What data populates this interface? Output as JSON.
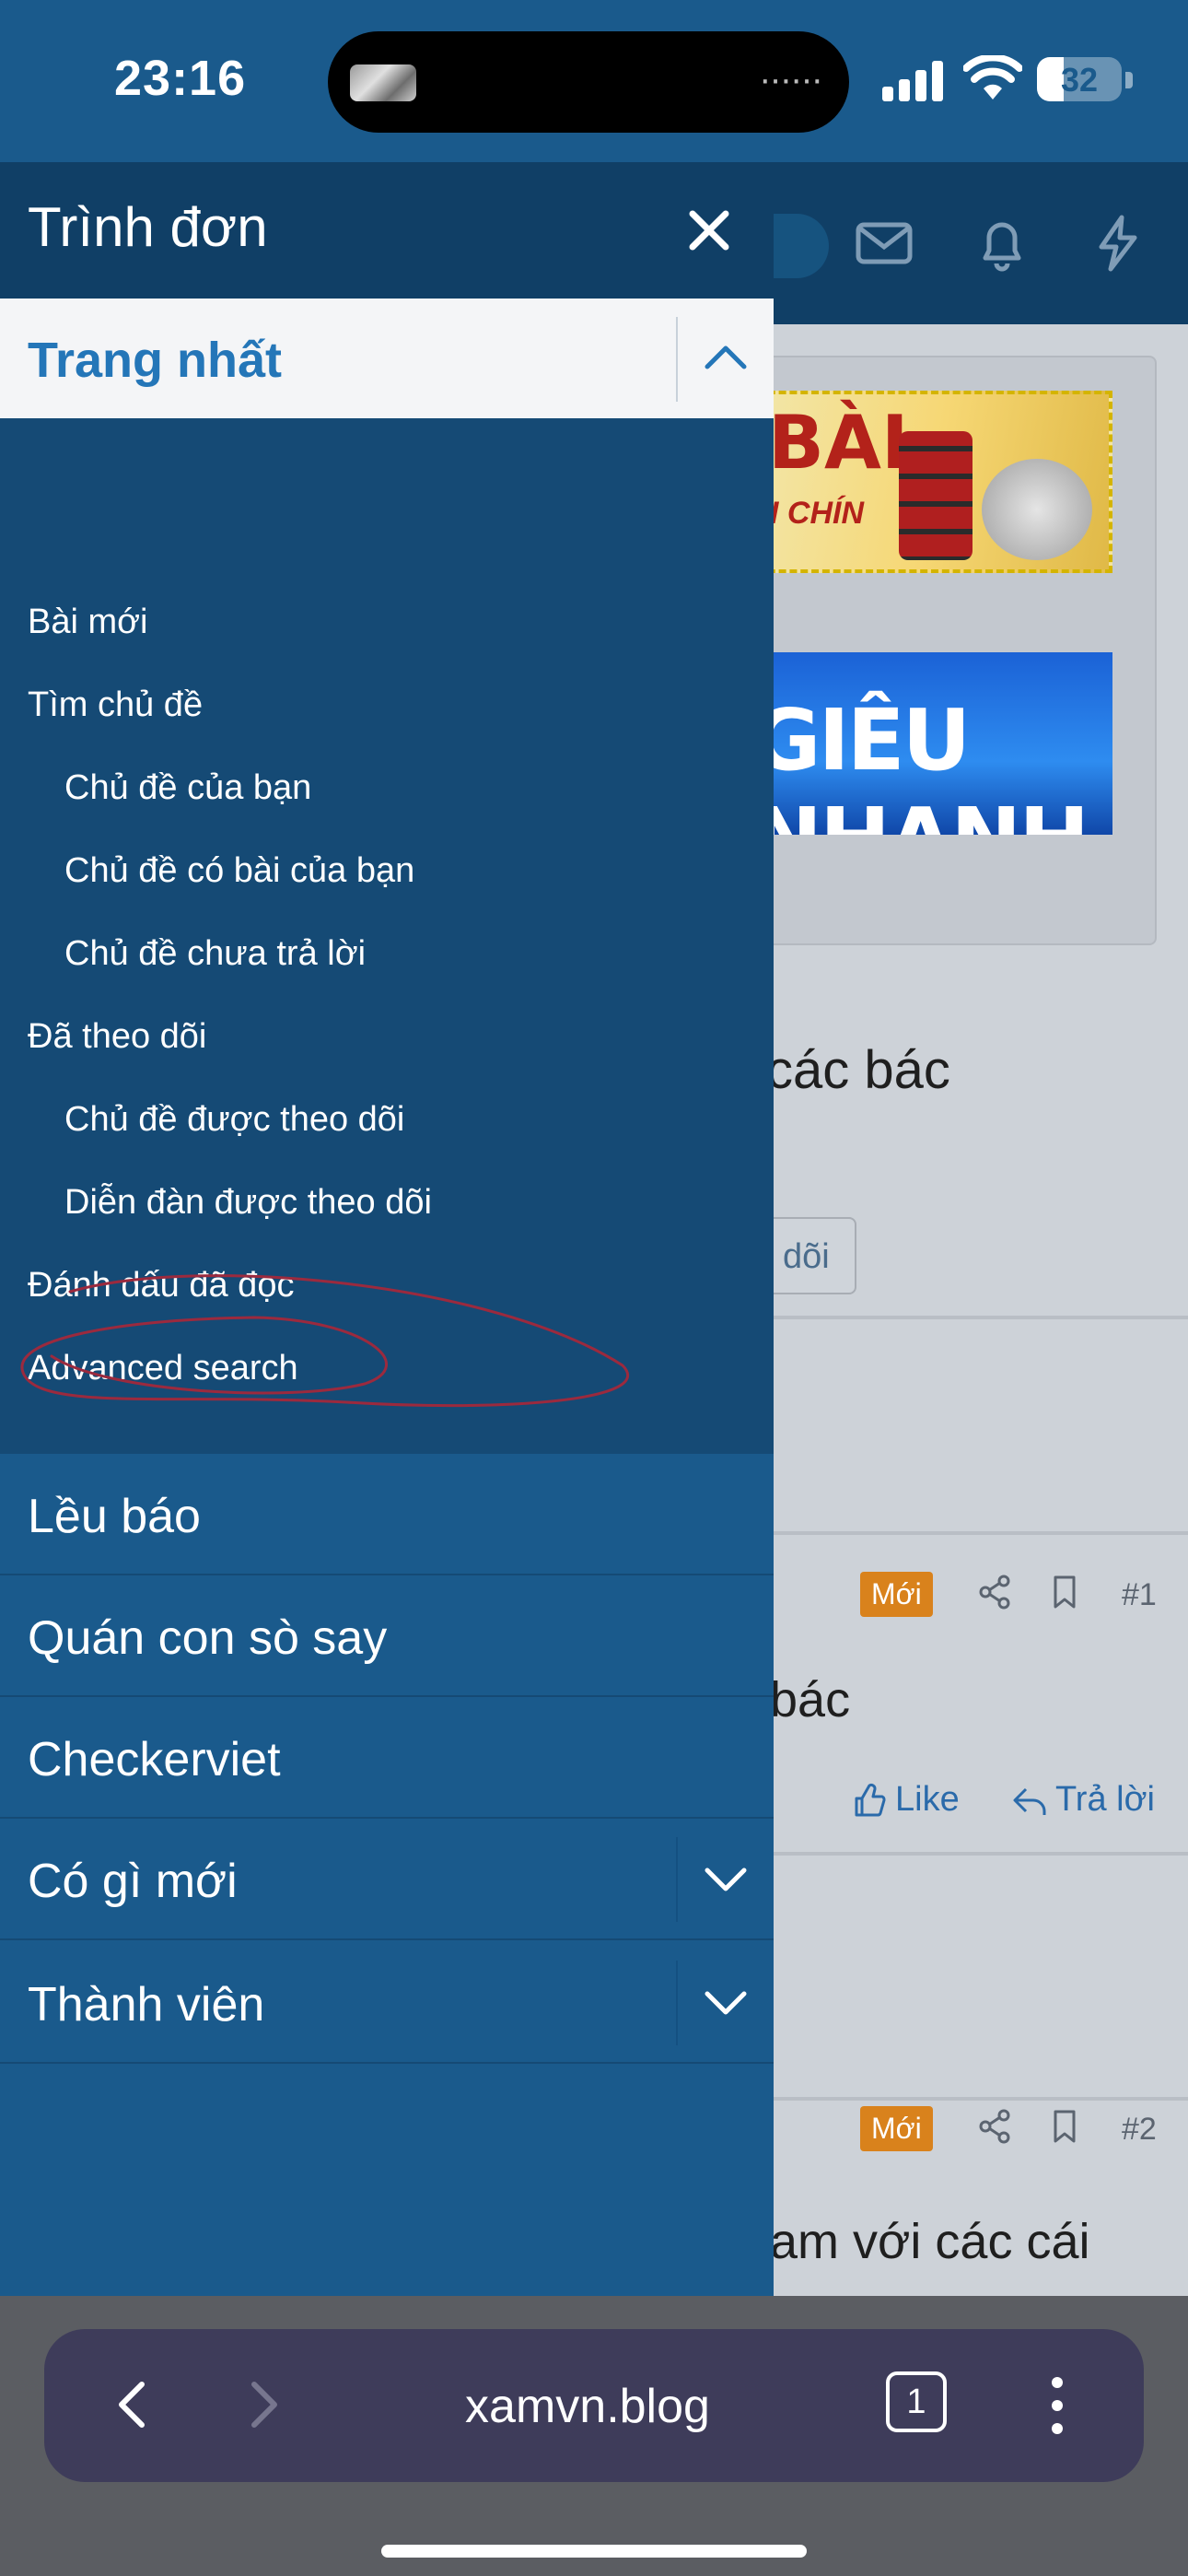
{
  "status_bar": {
    "time": "23:16",
    "battery_level": "32",
    "battery_fraction": 0.32
  },
  "menu": {
    "title": "Trình đơn",
    "active_item": {
      "label": "Trang nhất"
    },
    "subitems": [
      {
        "label": "Bài mới",
        "level": 1
      },
      {
        "label": "Tìm chủ đề",
        "level": 1
      },
      {
        "label": "Chủ đề của bạn",
        "level": 2
      },
      {
        "label": "Chủ đề có bài của bạn",
        "level": 2
      },
      {
        "label": "Chủ đề chưa trả lời",
        "level": 2
      },
      {
        "label": "Đã theo dõi",
        "level": 1
      },
      {
        "label": "Chủ đề được theo dõi",
        "level": 2
      },
      {
        "label": "Diễn đàn được theo dõi",
        "level": 2
      },
      {
        "label": "Đánh dấu đã đọc",
        "level": 1
      },
      {
        "label": "Advanced search",
        "level": 1
      }
    ],
    "items": [
      {
        "label": "Lều báo",
        "expandable": false
      },
      {
        "label": "Quán con sò say",
        "expandable": false
      },
      {
        "label": "Checkerviet",
        "expandable": false
      },
      {
        "label": "Có gì mới",
        "expandable": true
      },
      {
        "label": "Thành viên",
        "expandable": true
      }
    ],
    "annotation_color": "#9b2a3e"
  },
  "background": {
    "banner1_text": "BÀI",
    "banner1_sub": "I CHÍN",
    "banner2_text": "GIÊU NHANH",
    "thread_title": "các bác",
    "follow_button": "dõi",
    "posts": [
      {
        "badge": "Mới",
        "number": "#1",
        "title": "bác",
        "like": "Like",
        "reply": "Trả lời"
      },
      {
        "badge": "Mới",
        "number": "#2",
        "title": "am với các cái"
      }
    ]
  },
  "browser": {
    "url": "xamvn.blog",
    "tab_count": "1"
  },
  "colors": {
    "menu_bg": "#1a5a8c",
    "menu_header": "#103f66",
    "submenu_bg": "#154a75",
    "active_text": "#2476b8",
    "badge": "#d9821c"
  }
}
